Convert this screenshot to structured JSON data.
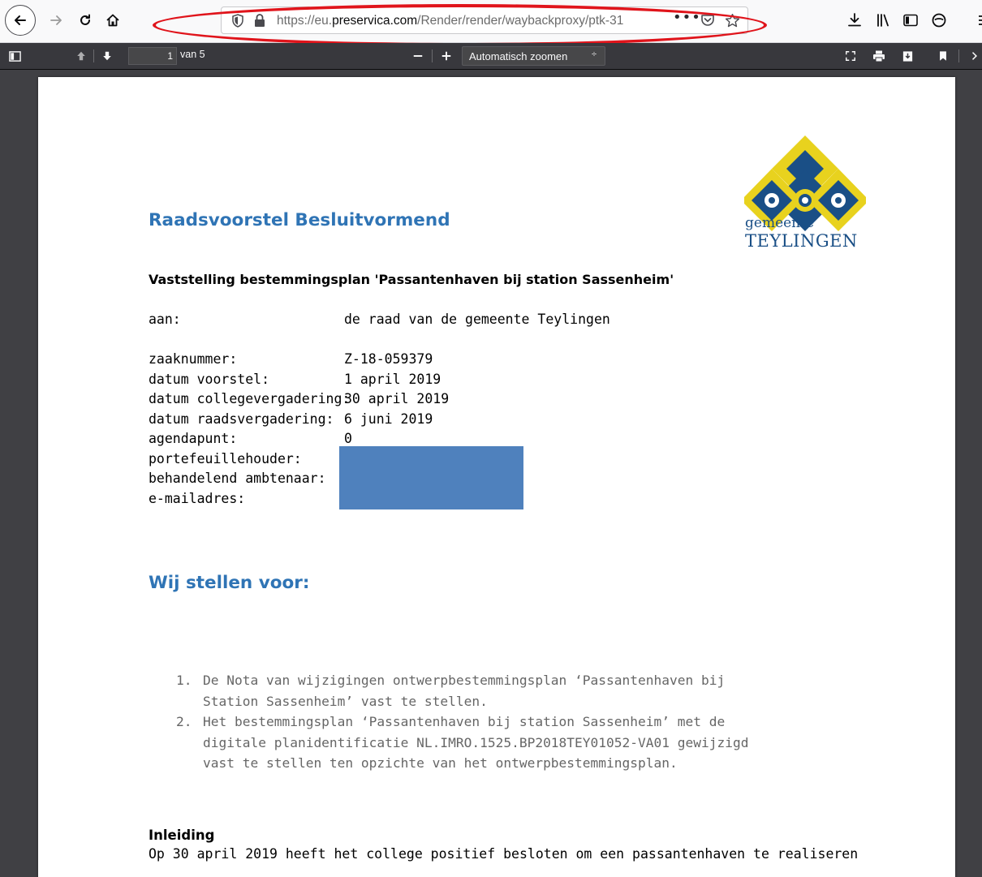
{
  "browser": {
    "url_prefix": "https://eu.",
    "url_host": "preservica.com",
    "url_path": "/Render/render/waybackproxy/ptk-31",
    "page_actions_label": "•••"
  },
  "pdf_toolbar": {
    "page_number": "1",
    "page_of": "van 5",
    "zoom_label": "Automatisch zoomen",
    "zoom_arrow": "÷"
  },
  "document": {
    "logo": {
      "line1": "gemeente",
      "line2": "TEYLINGEN",
      "letter": "T",
      "colors": {
        "yellow": "#e8d21e",
        "blue": "#1a4f86"
      }
    },
    "title": "Raadsvoorstel Besluitvormend",
    "subject": "Vaststelling bestemmingsplan 'Passantenhaven bij station Sassenheim'",
    "recipient": {
      "label": "aan:",
      "value": "de raad van de gemeente Teylingen"
    },
    "meta": [
      {
        "label": "zaaknummer:",
        "value": "Z-18-059379"
      },
      {
        "label": "datum voorstel:",
        "value": "1 april 2019"
      },
      {
        "label": "datum collegevergadering:",
        "value": "30 april 2019"
      },
      {
        "label": "datum raadsvergadering:",
        "value": "6 juni 2019"
      },
      {
        "label": "agendapunt:",
        "value": "0"
      },
      {
        "label": "portefeuillehouder:",
        "value": ""
      },
      {
        "label": "behandelend ambtenaar:",
        "value": ""
      },
      {
        "label": "e-mailadres:",
        "value": ""
      }
    ],
    "redaction_color": "#4f81bd",
    "proposal_heading": "Wij stellen voor:",
    "proposals": [
      {
        "num": "1.",
        "text": "De Nota van wijzigingen ontwerpbestemmingsplan ‘Passantenhaven bij Station Sassenheim’ vast te stellen."
      },
      {
        "num": "2.",
        "text": "Het bestemmingsplan ‘Passantenhaven bij station Sassenheim’ met de digitale planidentificatie NL.IMRO.1525.BP2018TEY01052-VA01 gewijzigd vast te stellen ten opzichte van het ontwerpbestemmingsplan."
      }
    ],
    "intro_heading": "Inleiding",
    "intro_text": "Op 30 april 2019 heeft het college positief besloten om een passantenhaven te realiseren"
  }
}
